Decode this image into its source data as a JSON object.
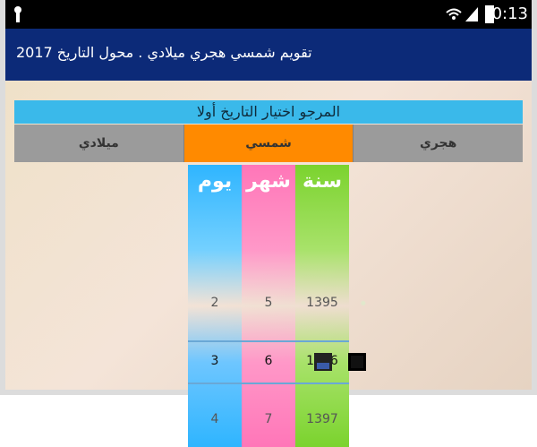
{
  "status_bar": {
    "time": "0:13"
  },
  "app_bar": {
    "title": "تقويم شمسي هجري ميلادي . محول التاريخ 2017"
  },
  "banner": {
    "text": "المرجو اختيار التاريخ أولا"
  },
  "tabs": [
    {
      "label": "ميلادي"
    },
    {
      "label": "شمسي"
    },
    {
      "label": "هجري"
    }
  ],
  "picker": {
    "headers": {
      "day": "يوم",
      "month": "شهر",
      "year": "سنة"
    },
    "values": {
      "day": {
        "prev": "2",
        "current": "3",
        "next": "4"
      },
      "month": {
        "prev": "5",
        "current": "6",
        "next": "7"
      },
      "year": {
        "prev": "1395",
        "current": "1396",
        "next": "1397"
      }
    }
  },
  "colors": {
    "status_bar": "#000000",
    "app_bar": "#0c2a78",
    "banner": "#3ab9ea",
    "tab_active": "#ff8a00",
    "tab_inactive": "#9b9b9b",
    "day_column": "#2fb5ff",
    "month_column": "#ff76b8",
    "year_column": "#7bd32e"
  }
}
